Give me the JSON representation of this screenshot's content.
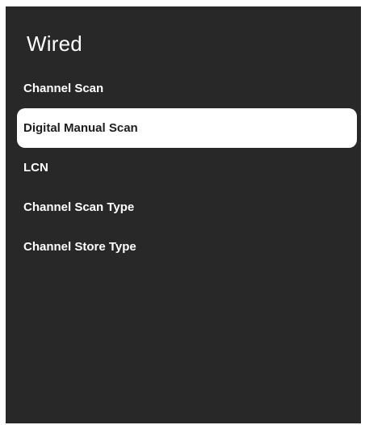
{
  "header": {
    "title": "Wired"
  },
  "menu": {
    "items": [
      {
        "label": "Channel Scan",
        "selected": false
      },
      {
        "label": "Digital Manual Scan",
        "selected": true
      },
      {
        "label": "LCN",
        "selected": false
      },
      {
        "label": "Channel Scan Type",
        "selected": false
      },
      {
        "label": "Channel Store Type",
        "selected": false
      }
    ]
  },
  "colors": {
    "panel_background": "#282828",
    "text": "#ffffff",
    "selected_background": "#ffffff",
    "selected_text": "#1e1e1e"
  }
}
